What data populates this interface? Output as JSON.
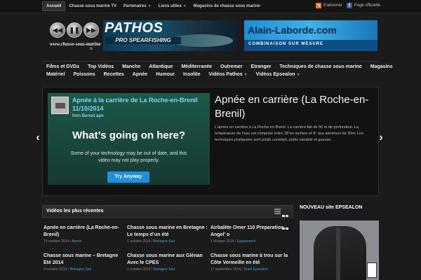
{
  "topbar": {
    "items": [
      {
        "label": "Accueil",
        "caret": false,
        "active": true
      },
      {
        "label": "Chasse sous marine TV",
        "caret": false
      },
      {
        "label": "Partenaires",
        "caret": true
      },
      {
        "label": "Liens utiles",
        "caret": true
      },
      {
        "label": "Magasins de chasse sous marine",
        "caret": false
      }
    ],
    "subscribe": "S'abonner",
    "official_page": "Page officielle"
  },
  "header": {
    "logo_text": "www.chasse-sous-marine",
    "logo_tld": ".tv",
    "banner1_title": "PATHOS",
    "banner1_sub": "PRO SPEARFISHING",
    "banner2_title": "Alain-Laborde.com",
    "banner2_sub": "COMBINAISON SUR MESURE"
  },
  "nav": {
    "row1": [
      {
        "label": "Films et DVDs"
      },
      {
        "label": "Top Vidéos"
      },
      {
        "label": "Manche"
      },
      {
        "label": "Atlantique"
      },
      {
        "label": "Méditerranée"
      },
      {
        "label": "Outremer"
      },
      {
        "label": "Etranger"
      },
      {
        "label": "Techniques de chasse sous marine"
      },
      {
        "label": "Magasins"
      }
    ],
    "row2": [
      {
        "label": "Matériel",
        "caret": false
      },
      {
        "label": "Poissons",
        "caret": false
      },
      {
        "label": "Recettes",
        "caret": false
      },
      {
        "label": "Apnée",
        "caret": false
      },
      {
        "label": "Humour",
        "caret": false
      },
      {
        "label": "Insolite",
        "caret": false
      },
      {
        "label": "Vidéos Pathos",
        "caret": true
      },
      {
        "label": "Vidéos Epsealon",
        "caret": true
      }
    ]
  },
  "slider": {
    "video_title": "Apnée à la carrière de La Roche-en-Brenil 11/10/2014",
    "video_from_prefix": "from",
    "video_author": "Benoit apn",
    "error_title": "What’s going on here?",
    "error_msg": "Some of your technology may be out of date, and this video may not play properly.",
    "try_button": "Try Anyway",
    "title": "Apnée en carrière (La Roche-en-Brenil)",
    "description": "L'apnée en carrière à La Roche-en-Brenil. La carrière fait de 50 m de profondeur. La température de l'eau est comprise entre 18°en surface et 8° aux alentours de 30m. Les techniques pratiquées sont poids constant, poids variable et gueuse.",
    "prev_arrow": "‹",
    "next_arrow": "›"
  },
  "recent": {
    "heading": "Vidéos les plus récentes",
    "posts": [
      {
        "title": "Apnée en carrière (La Roche-en-Brenil)",
        "date": "13 octobre 2014",
        "sep": " / ",
        "category": "Apnée"
      },
      {
        "title": "Chasse sous marine en Bretagne : Le temps d’un été",
        "date": "1 octobre 2014",
        "sep": " / ",
        "category": "Bretagne Sud"
      },
      {
        "title": "Airbalète Omer 110 Preparation Angel' o",
        "date": "1 octobre 2014",
        "sep": " / ",
        "category": "Equipement"
      },
      {
        "title": "Chasse sous marine – Bretagne Eté 2014",
        "date": "3 octobre 2014",
        "sep": " / ",
        "category": "Bretagne Sud"
      },
      {
        "title": "Chasse sous marine aux Glénan Avec le CPES",
        "date": "1 octobre 2014",
        "sep": " / ",
        "category": "Bretagne Sud"
      },
      {
        "title": "Chasse sous marine à trou sur la Côte Vermeille en été",
        "date": "17 septembre 2014",
        "sep": " / ",
        "category": "Team Epsealon"
      }
    ]
  },
  "sidebar": {
    "heading": "NOUVEAU site EPSEALON"
  },
  "colors": {
    "background": "#1b1b1b",
    "accent_link": "#3ca0e0",
    "video_title": "#7fd4ff"
  }
}
